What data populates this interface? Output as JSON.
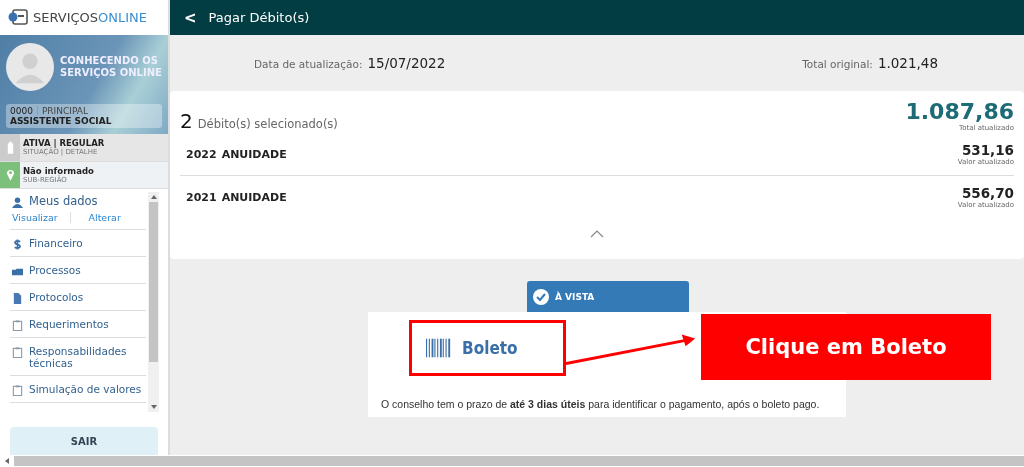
{
  "brand": {
    "name_part1": "SERVIÇOS",
    "name_part2": "ONLINE"
  },
  "profile": {
    "title": "CONHECENDO OS SERVIÇOS ONLINE",
    "code": "0000",
    "role": "PRINCIPAL",
    "profession": "ASSISTENTE SOCIAL"
  },
  "status_rows": [
    {
      "kind": "tag",
      "value": "ATIVA | REGULAR",
      "label": "SITUAÇÃO | DETALHE"
    },
    {
      "kind": "pin",
      "value": "Não informado",
      "label": "SUB-REGIÃO"
    }
  ],
  "sidebar": {
    "items": [
      {
        "kind": "person",
        "label": "Meus dados",
        "links": [
          "Visualizar",
          "Alterar"
        ]
      },
      {
        "kind": "dollar",
        "label": "Financeiro"
      },
      {
        "kind": "folder",
        "label": "Processos"
      },
      {
        "kind": "document",
        "label": "Protocolos"
      },
      {
        "kind": "clipboard",
        "label": "Requerimentos"
      },
      {
        "kind": "clipboard",
        "label": "Responsabilidades técnicas"
      },
      {
        "kind": "clipboard",
        "label": "Simulação de valores"
      }
    ],
    "logout": "SAIR"
  },
  "header": {
    "back": "<",
    "title": "Pagar Débito(s)"
  },
  "summary": {
    "date_label": "Data de atualização:",
    "date": "15/07/2022",
    "original_label": "Total original:",
    "original": "1.021,48"
  },
  "debts": {
    "count": "2",
    "count_label": "Débito(s) selecionado(s)",
    "total": "1.087,86",
    "total_label": "Total atualizado",
    "rows": [
      {
        "year": "2022",
        "type": "ANUIDADE",
        "value": "531,16",
        "value_label": "Valor atualizado"
      },
      {
        "year": "2021",
        "type": "ANUIDADE",
        "value": "556,70",
        "value_label": "Valor atualizado"
      }
    ]
  },
  "payment": {
    "tabs": [
      {
        "label": "À VISTA",
        "selected": true
      }
    ],
    "option": "Boleto",
    "note": "O conselho tem o prazo de **até 3 dias úteis** para identificar o pagamento, após o boleto pago."
  },
  "annotation": {
    "text": "Clique em Boleto"
  }
}
